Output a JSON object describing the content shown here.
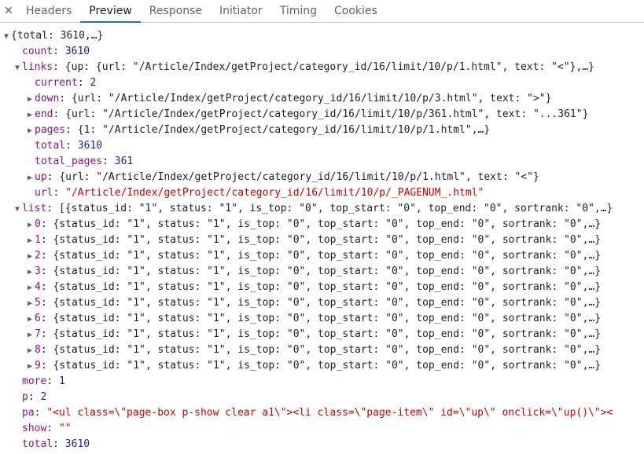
{
  "tabs": {
    "close": "✕",
    "items": [
      "Headers",
      "Preview",
      "Response",
      "Initiator",
      "Timing",
      "Cookies"
    ],
    "active_index": 1
  },
  "tree": {
    "root_preview": "{total: 3610,…}",
    "count": {
      "key": "count",
      "value": "3610"
    },
    "links": {
      "key": "links",
      "preview": "{up: {url: \"/Article/Index/getProject/category_id/16/limit/10/p/1.html\", text: \"<\"},…}",
      "current": {
        "key": "current",
        "value": "2"
      },
      "down": {
        "key": "down",
        "preview": "{url: \"/Article/Index/getProject/category_id/16/limit/10/p/3.html\", text: \">\"}"
      },
      "end": {
        "key": "end",
        "preview": "{url: \"/Article/Index/getProject/category_id/16/limit/10/p/361.html\", text: \"...361\"}"
      },
      "pages": {
        "key": "pages",
        "preview": "{1: \"/Article/Index/getProject/category_id/16/limit/10/p/1.html\",…}"
      },
      "total": {
        "key": "total",
        "value": "3610"
      },
      "total_pages": {
        "key": "total_pages",
        "value": "361"
      },
      "up": {
        "key": "up",
        "preview": "{url: \"/Article/Index/getProject/category_id/16/limit/10/p/1.html\", text: \"<\"}"
      },
      "url": {
        "key": "url",
        "value": "\"/Article/Index/getProject/category_id/16/limit/10/p/_PAGENUM_.html\""
      }
    },
    "list": {
      "key": "list",
      "preview": "[{status_id: \"1\", status: \"1\", is_top: \"0\", top_start: \"0\", top_end: \"0\", sortrank: \"0\",…}",
      "items": [
        {
          "key": "0",
          "preview": "{status_id: \"1\", status: \"1\", is_top: \"0\", top_start: \"0\", top_end: \"0\", sortrank: \"0\",…}"
        },
        {
          "key": "1",
          "preview": "{status_id: \"1\", status: \"1\", is_top: \"0\", top_start: \"0\", top_end: \"0\", sortrank: \"0\",…}"
        },
        {
          "key": "2",
          "preview": "{status_id: \"1\", status: \"1\", is_top: \"0\", top_start: \"0\", top_end: \"0\", sortrank: \"0\",…}"
        },
        {
          "key": "3",
          "preview": "{status_id: \"1\", status: \"1\", is_top: \"0\", top_start: \"0\", top_end: \"0\", sortrank: \"0\",…}"
        },
        {
          "key": "4",
          "preview": "{status_id: \"1\", status: \"1\", is_top: \"0\", top_start: \"0\", top_end: \"0\", sortrank: \"0\",…}"
        },
        {
          "key": "5",
          "preview": "{status_id: \"1\", status: \"1\", is_top: \"0\", top_start: \"0\", top_end: \"0\", sortrank: \"0\",…}"
        },
        {
          "key": "6",
          "preview": "{status_id: \"1\", status: \"1\", is_top: \"0\", top_start: \"0\", top_end: \"0\", sortrank: \"0\",…}"
        },
        {
          "key": "7",
          "preview": "{status_id: \"1\", status: \"1\", is_top: \"0\", top_start: \"0\", top_end: \"0\", sortrank: \"0\",…}"
        },
        {
          "key": "8",
          "preview": "{status_id: \"1\", status: \"1\", is_top: \"0\", top_start: \"0\", top_end: \"0\", sortrank: \"0\",…}"
        },
        {
          "key": "9",
          "preview": "{status_id: \"1\", status: \"1\", is_top: \"0\", top_start: \"0\", top_end: \"0\", sortrank: \"0\",…}"
        }
      ]
    },
    "more": {
      "key": "more",
      "value": "1"
    },
    "p": {
      "key": "p",
      "value": "2"
    },
    "pa": {
      "key": "pa",
      "value": "\"<ul class=\\\"page-box p-show clear a1\\\"><li class=\\\"page-item\\\" id=\\\"up\\\" onclick=\\\"up()\\\"><"
    },
    "show": {
      "key": "show",
      "value": "\"\""
    },
    "total": {
      "key": "total",
      "value": "3610"
    }
  },
  "colors": {
    "key": "#881280",
    "number": "#1a1aa6",
    "string": "#c80000",
    "accent": "#1a73e8"
  }
}
